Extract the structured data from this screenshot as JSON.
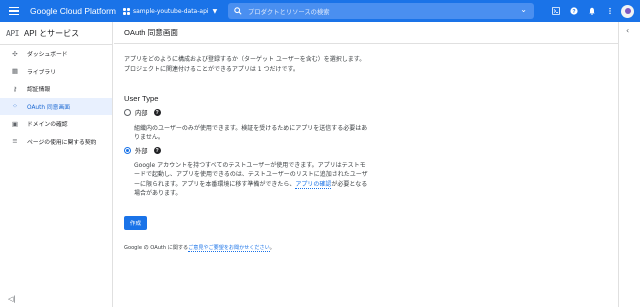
{
  "topbar": {
    "brand": "Google Cloud Platform",
    "project_name": "sample-youtube-data-api",
    "project_caret": "▼",
    "search_placeholder": "プロダクトとリソースの検索",
    "search_dropdown": "⌄",
    "icons": [
      "terminal-icon",
      "help-icon",
      "notifications-icon",
      "more-vert-icon",
      "account-avatar"
    ]
  },
  "sidebar": {
    "logo": "API",
    "title": "API とサービス",
    "items": [
      {
        "label": "ダッシュボード",
        "icon": "✣",
        "icon_name": "dashboard-icon",
        "active": false
      },
      {
        "label": "ライブラリ",
        "icon": "▦",
        "icon_name": "library-icon",
        "active": false
      },
      {
        "label": "認証情報",
        "icon": "⚷",
        "icon_name": "key-icon",
        "active": false
      },
      {
        "label": "OAuth 同意画面",
        "icon": "⁘",
        "icon_name": "oauth-icon",
        "active": true
      },
      {
        "label": "ドメインの確認",
        "icon": "▣",
        "icon_name": "domain-icon",
        "active": false
      },
      {
        "label": "ページの使用に関する契約",
        "icon": "≡",
        "icon_name": "agreements-icon",
        "active": false
      }
    ],
    "collapse": "◁|"
  },
  "main": {
    "title": "OAuth 同意画面",
    "description": "アプリをどのように構成および登録するか（ターゲット ユーザーを含む）を選択します。プロジェクトに関連付けることができるアプリは 1 つだけです。",
    "user_type_heading": "User Type",
    "options": [
      {
        "label": "内部",
        "checked": false,
        "help": "?",
        "description": "組織内のユーザーのみが使用できます。検証を受けるためにアプリを送信する必要はありません。"
      },
      {
        "label": "外部",
        "checked": true,
        "help": "?",
        "description_before": "Google アカウントを持つすべてのテストユーザーが使用できます。アプリはテストモードで起動し、アプリを使用できるのは、テストユーザーのリストに追加されたユーザーに限られます。アプリを本番環境に移す準備ができたら、",
        "description_link": "アプリの確認",
        "description_after": "が必要となる場合があります。"
      }
    ],
    "create_label": "作成",
    "feedback_before": "Google の OAuth に関する",
    "feedback_link": "ご意見やご要望をお聞かせください",
    "feedback_after": "。"
  },
  "rightrail": {
    "chevron": "‹"
  },
  "colors": {
    "topbar": "#1a73e8",
    "active_bg": "#e8f0fe",
    "active_text": "#1967d2",
    "link": "#1a73e8"
  }
}
